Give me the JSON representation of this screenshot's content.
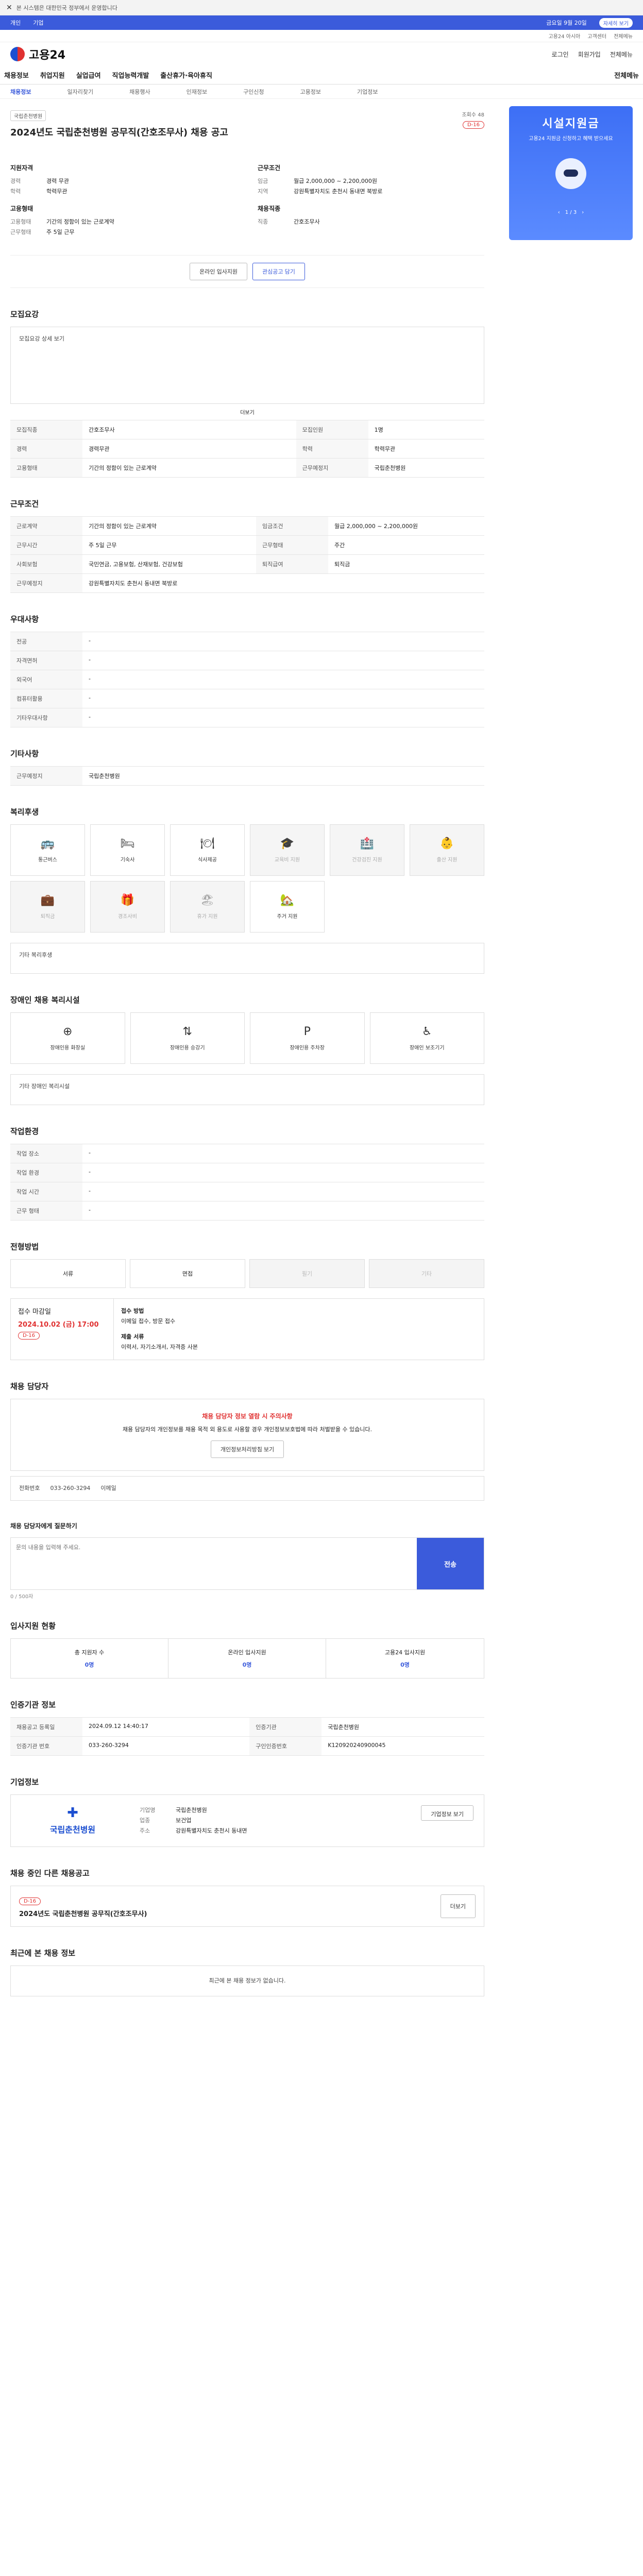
{
  "notice": {
    "text": "본 시스템은 대한민국 정부에서 운영합니다"
  },
  "gnb": {
    "tab1": "개인",
    "tab2": "기업",
    "right1": "금요일 9월 20일",
    "right_pill": "자세히 보기"
  },
  "gnb2": [
    "고용24 아시아",
    "고객센터",
    "전체메뉴"
  ],
  "header": {
    "logo": "고용24",
    "links": [
      "로그인",
      "회원가입",
      "전체메뉴"
    ]
  },
  "nav": {
    "items": [
      "채용정보",
      "취업지원",
      "실업급여",
      "직업능력개발",
      "출산휴가·육아휴직"
    ],
    "right": "전체메뉴"
  },
  "subnav": [
    "채용정보",
    "일자리찾기",
    "채용행사",
    "인재정보",
    "구인신청",
    "고용정보",
    "기업정보"
  ],
  "job": {
    "tag": "국립춘천병원",
    "title": "2024년도 국립춘천병원 공무직(간호조무사) 채용 공고",
    "views_label": "조회수",
    "views": "48",
    "dday": "D-16",
    "left_h": "지원자격",
    "right_h": "근무조건",
    "left_rows": [
      {
        "k": "경력",
        "v": "경력 무관"
      },
      {
        "k": "학력",
        "v": "학력무관"
      }
    ],
    "right_rows": [
      {
        "k": "임금",
        "v": "월급 2,000,000 ~ 2,200,000원"
      },
      {
        "k": "지역",
        "v": "강원특별자치도 춘천시 동내면 북방로"
      }
    ],
    "left_h2": "고용형태",
    "right_h2": "채용직종",
    "left_rows2": [
      {
        "k": "고용형태",
        "v": "기간의 정함이 있는 근로계약"
      },
      {
        "k": "근무형태",
        "v": "주 5일 근무"
      }
    ],
    "right_rows2": [
      {
        "k": "직종",
        "v": "간호조무사"
      }
    ],
    "btn_apply": "온라인 입사지원",
    "btn_scrap": "관심공고 담기"
  },
  "sec_qual": {
    "title": "모집요강",
    "detail": "모집요강 상세 보기",
    "more": "더보기",
    "rows": [
      {
        "k": "모집직종",
        "v": "간호조무사",
        "k2": "모집인원",
        "v2": "1명"
      },
      {
        "k": "경력",
        "v": "경력무관",
        "k2": "학력",
        "v2": "학력무관"
      },
      {
        "k": "고용형태",
        "v": "기간의 정함이 있는 근로계약",
        "k2": "근무예정지",
        "v2": "국립춘천병원"
      }
    ]
  },
  "sec_cond": {
    "title": "근무조건",
    "rows": [
      {
        "k": "근로계약",
        "v": "기간의 정함이 있는 근로계약",
        "k2": "임금조건",
        "v2": "월급 2,000,000 ~ 2,200,000원"
      },
      {
        "k": "근무시간",
        "v": "주 5일 근무",
        "k2": "근무형태",
        "v2": "주간"
      },
      {
        "k": "사회보험",
        "v": "국민연금, 고용보험, 산재보험, 건강보험",
        "k2": "퇴직급여",
        "v2": "퇴직금"
      },
      {
        "k": "근무예정지",
        "v": "강원특별자치도 춘천시 동내면 북방로",
        "k2": "",
        "v2": ""
      }
    ]
  },
  "sec_pref": {
    "title": "우대사항",
    "rows": [
      "전공",
      "자격면허",
      "외국어",
      "컴퓨터활용",
      "기타우대사항"
    ]
  },
  "sec_etc": {
    "title": "기타사항",
    "rows": [
      {
        "k": "근무예정지",
        "v": "국립춘천병원"
      }
    ]
  },
  "sec_welfare": {
    "title": "복리후생",
    "items": [
      {
        "ic": "🚌",
        "label": "통근버스",
        "on": true
      },
      {
        "ic": "🛏",
        "label": "기숙사",
        "on": true
      },
      {
        "ic": "🍽",
        "label": "식사제공",
        "on": true
      },
      {
        "ic": "🎓",
        "label": "교육비 지원",
        "on": false
      },
      {
        "ic": "🏥",
        "label": "건강검진 지원",
        "on": false
      },
      {
        "ic": "👶",
        "label": "출산 지원",
        "on": false
      },
      {
        "ic": "💼",
        "label": "퇴직금",
        "on": false
      },
      {
        "ic": "🎁",
        "label": "경조사비",
        "on": false
      },
      {
        "ic": "🏖",
        "label": "휴가 지원",
        "on": false
      },
      {
        "ic": "🏡",
        "label": "주거 지원",
        "on": true
      }
    ],
    "other": "기타 복리후생"
  },
  "sec_disab": {
    "title": "장애인 채용 복리시설",
    "items": [
      "장애인용 화장실",
      "장애인용 승강기",
      "장애인용 주차장",
      "장애인 보조기기"
    ],
    "other": "기타 장애인 복리시설"
  },
  "sec_env": {
    "title": "작업환경",
    "rows": [
      "작업 장소",
      "작업 환경",
      "작업 시간",
      "근무 형태"
    ]
  },
  "sec_proc": {
    "title": "전형방법",
    "steps": [
      "서류",
      "면접",
      "필기",
      "기타"
    ],
    "deadline_label": "접수 마감일",
    "deadline": "2024.10.02 (금) 17:00",
    "dday": "D-16",
    "method_label": "접수 방법",
    "method": "이메일 접수, 방문 접수",
    "docs_label": "제출 서류",
    "docs": "이력서, 자기소개서, 자격증 사본"
  },
  "sec_contact": {
    "title": "채용 담당자",
    "warn": "채용 담당자 정보 열람 시 주의사항",
    "warn_body": "채용 담당자의 개인정보를 채용 목적 외 용도로 사용할 경우 개인정보보호법에 따라 처벌받을 수 있습니다.",
    "btn": "개인정보처리방침 보기",
    "tel_label": "전화번호",
    "tel": "033-260-3294",
    "email_label": "이메일"
  },
  "sec_inquiry": {
    "title": "채용 담당자에게 질문하기",
    "placeholder": "문의 내용을 입력해 주세요.",
    "count": "0 / 500자",
    "send": "전송"
  },
  "sec_status": {
    "title": "입사지원 현황",
    "items": [
      {
        "label": "총 지원자 수",
        "n": "0명"
      },
      {
        "label": "온라인 입사지원",
        "n": "0명"
      },
      {
        "label": "고용24 입사지원",
        "n": "0명"
      }
    ]
  },
  "sec_info": {
    "title": "인증기관 정보",
    "rows": [
      {
        "k": "채용공고 등록일",
        "v": "2024.09.12 14:40:17",
        "k2": "인증기관",
        "v2": "국립춘천병원"
      },
      {
        "k": "인증기관 번호",
        "v": "033-260-3294",
        "k2": "구인인증번호",
        "v2": "K120920240900045"
      }
    ]
  },
  "sec_org": {
    "title": "기업정보",
    "name": "국립춘천병원",
    "rows": [
      {
        "k": "기업명",
        "v": "국립춘천병원"
      },
      {
        "k": "업종",
        "v": "보건업"
      },
      {
        "k": "주소",
        "v": "강원특별자치도 춘천시 동내면"
      }
    ],
    "btn": "기업정보 보기"
  },
  "sec_related": {
    "title": "채용 중인 다른 채용공고",
    "dday": "D-16",
    "item": "2024년도 국립춘천병원 공무직(간호조무사)",
    "btn": "더보기"
  },
  "sec_recent": {
    "title": "최근에 본 채용 정보",
    "empty": "최근에 본 채용 정보가 없습니다."
  },
  "aside": {
    "t1": "시설지원금",
    "t2": "고용24 지원금 신청하고 혜택 받으세요",
    "nav": "1 / 3"
  }
}
